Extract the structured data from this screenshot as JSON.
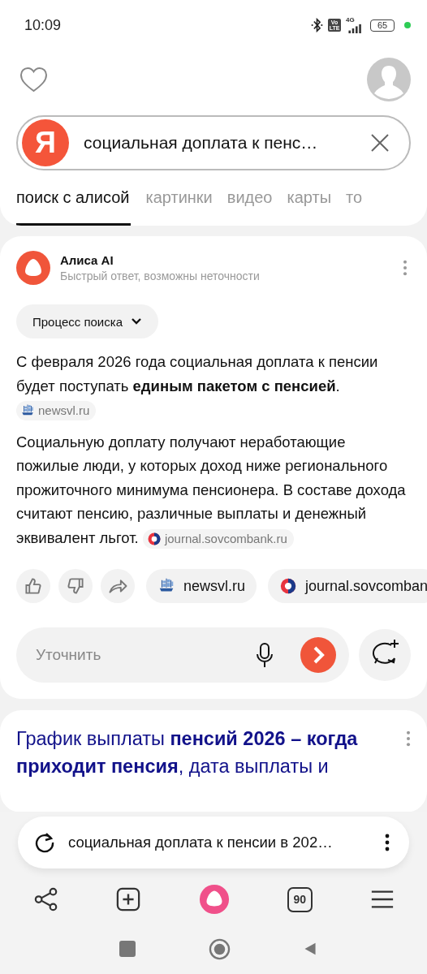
{
  "status_bar": {
    "time": "10:09",
    "volte": "Vo LTE",
    "network": "4G",
    "battery": "65"
  },
  "search": {
    "logo": "Я",
    "query": "социальная доплата к пенс…"
  },
  "tabs": [
    {
      "label": "поиск с алисой",
      "selected": true
    },
    {
      "label": "картинки",
      "selected": false
    },
    {
      "label": "видео",
      "selected": false
    },
    {
      "label": "карты",
      "selected": false
    },
    {
      "label": "то",
      "selected": false
    }
  ],
  "answer": {
    "title": "Алиса AI",
    "subtitle": "Быстрый ответ, возможны неточности",
    "process_button": "Процесс поиска",
    "paragraphs": [
      {
        "text": "С февраля 2026 года социальная доплата к пенсии будет поступать **единым пакетом с пенсией**.",
        "source": {
          "label": "newsvl.ru",
          "kind": "ship"
        }
      },
      {
        "text": "Социальную доплату получают неработающие пожилые люди, у которых доход ниже регионального прожиточного минимума пенсионера. В составе дохода считают пенсию, различные выплаты и денежный эквивалент льгот.",
        "source": {
          "label": "journal.sovcombank.ru",
          "kind": "bank"
        }
      }
    ],
    "sources": [
      {
        "label": "newsvl.ru",
        "kind": "ship"
      },
      {
        "label": "journal.sovcomban",
        "kind": "bank"
      }
    ],
    "refine": {
      "placeholder": "Уточнить"
    }
  },
  "result": {
    "title": "График выплаты **пенсий 2026 – когда приходит пенсия**, дата выплаты и"
  },
  "current_query": "социальная доплата к пенсии в 202…",
  "toolbar": {
    "tabs_count": "90"
  }
}
